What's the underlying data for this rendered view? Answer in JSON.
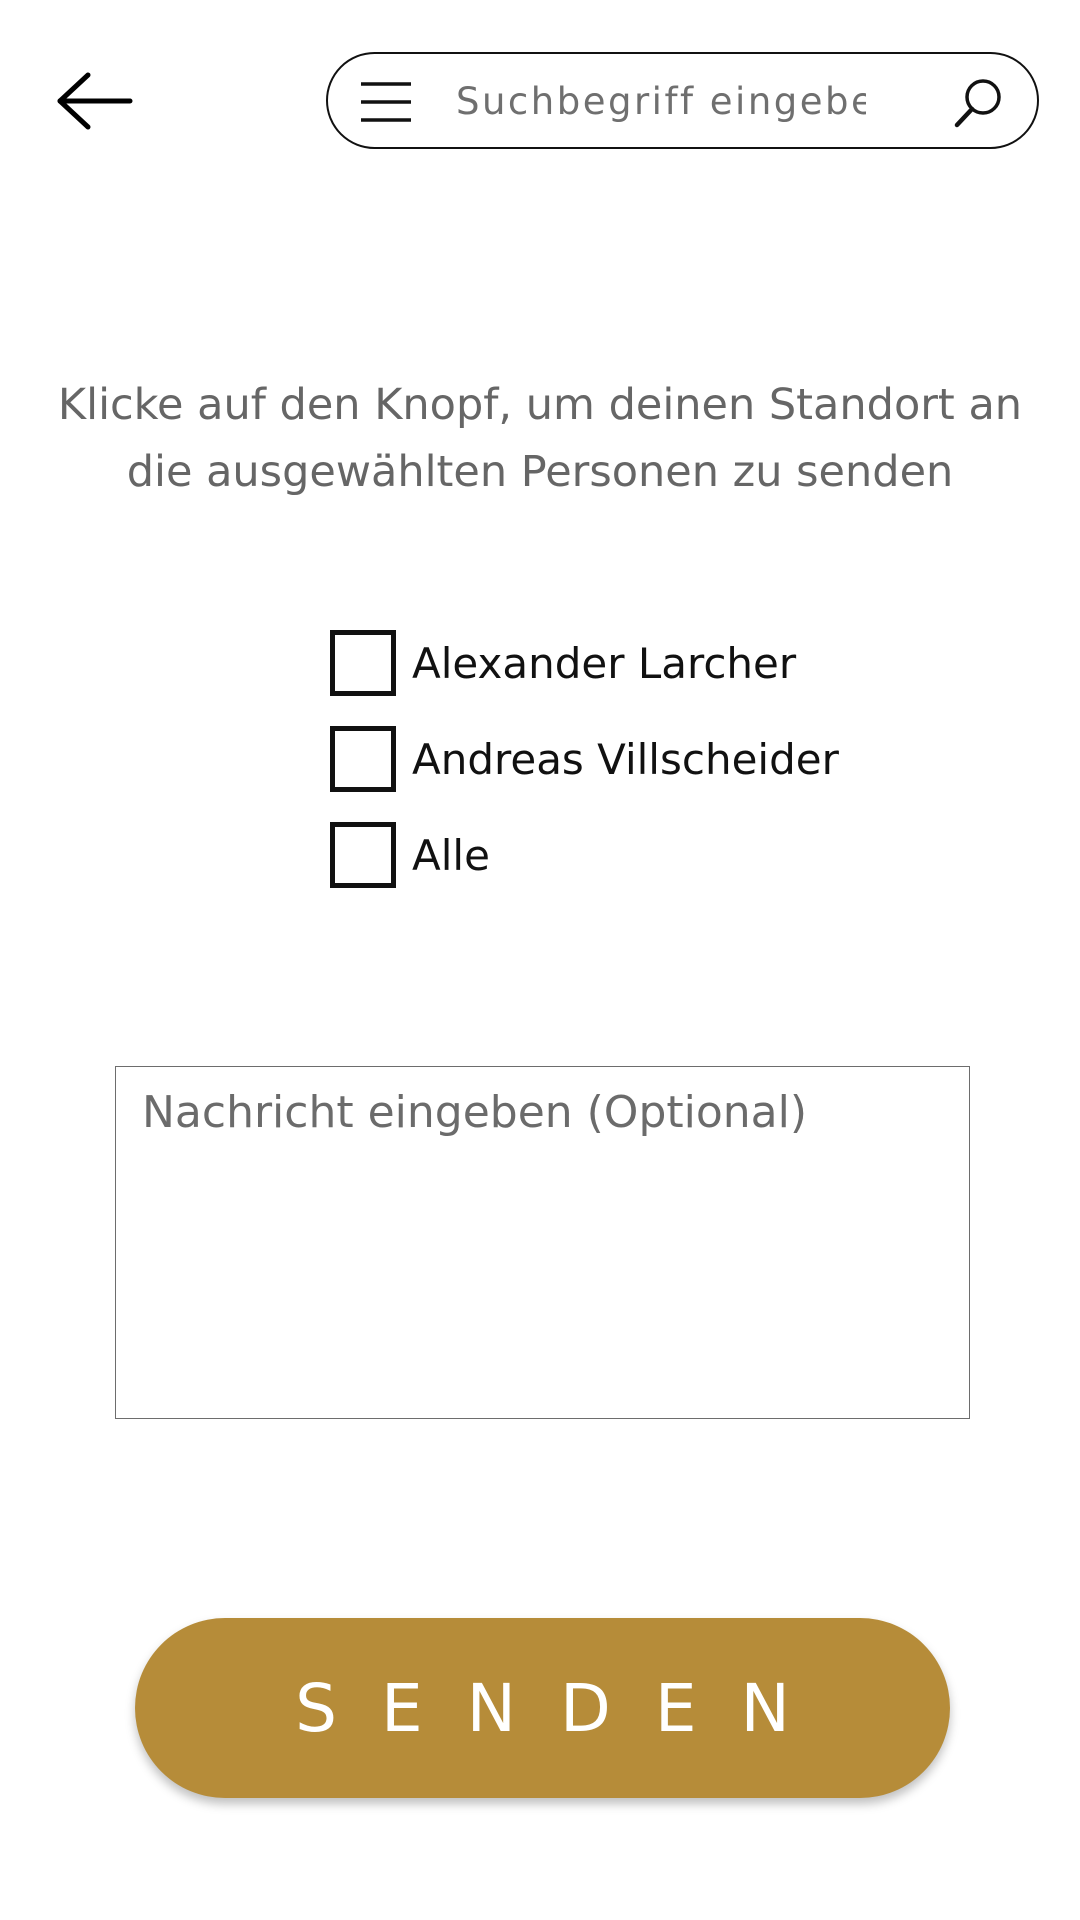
{
  "header": {
    "back_icon": "arrow-left-icon",
    "menu_icon": "hamburger-menu-icon",
    "search_placeholder": "Suchbegriff eingeben",
    "search_value": "",
    "search_icon": "search-icon"
  },
  "instruction": "Klicke auf den Knopf, um deinen Standort an die ausgewählten Personen zu senden",
  "recipients": [
    {
      "label": "Alexander Larcher",
      "checked": false
    },
    {
      "label": "Andreas Villscheider",
      "checked": false
    },
    {
      "label": "Alle",
      "checked": false
    }
  ],
  "message": {
    "placeholder": "Nachricht eingeben (Optional)",
    "value": ""
  },
  "send_button": {
    "label": "SENDEN",
    "color": "#b68c39"
  }
}
